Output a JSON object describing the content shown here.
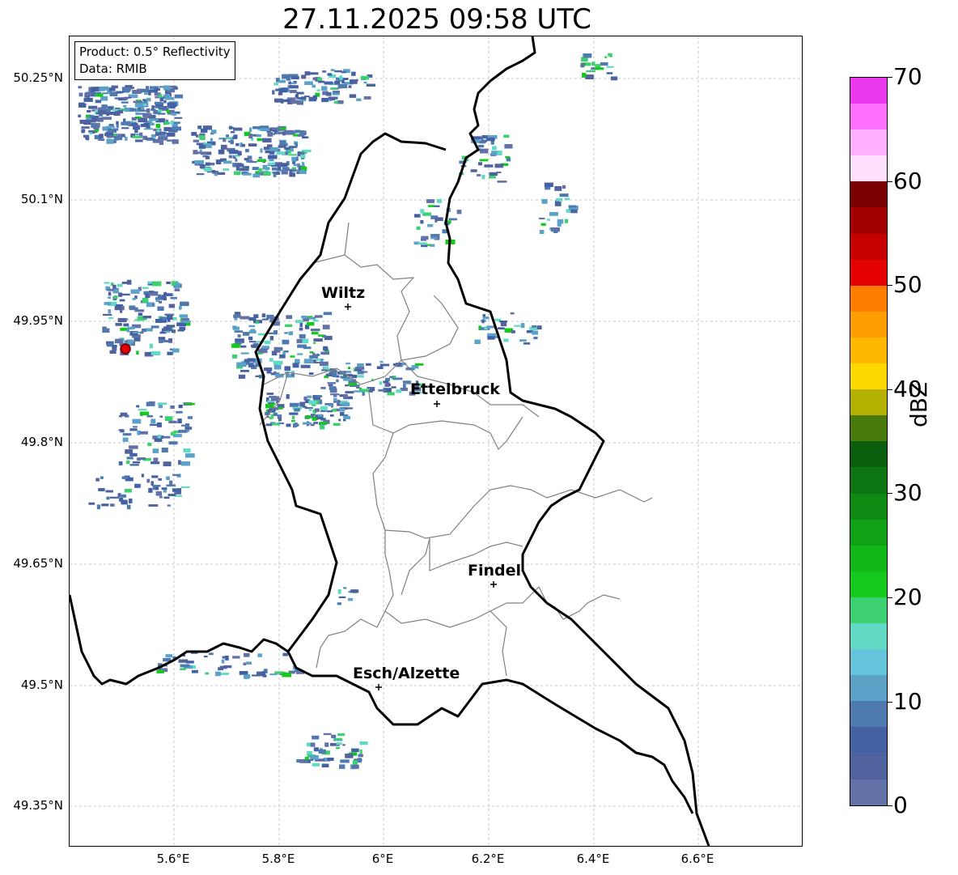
{
  "title": "27.11.2025 09:58 UTC",
  "info": {
    "line1": "Product: 0.5° Reflectivity",
    "line2": "Data: RMIB"
  },
  "y_ticks": [
    "50.25°N",
    "50.1°N",
    "49.95°N",
    "49.8°N",
    "49.65°N",
    "49.5°N",
    "49.35°N"
  ],
  "x_ticks": [
    "5.6°E",
    "5.8°E",
    "6°E",
    "6.2°E",
    "6.4°E",
    "6.6°E"
  ],
  "cities": {
    "wiltz": "Wiltz",
    "ettelbruck": "Ettelbruck",
    "findel": "Findel",
    "esch": "Esch/Alzette"
  },
  "colorbar": {
    "label": "dBZ",
    "ticks": [
      "70",
      "60",
      "50",
      "40",
      "30",
      "20",
      "10",
      "0"
    ],
    "colors": [
      "#6272a8",
      "#51639e",
      "#4461a3",
      "#4e7ab0",
      "#5ba1c8",
      "#66c3dc",
      "#62d9c5",
      "#3cd070",
      "#14c81c",
      "#12b818",
      "#10a114",
      "#0e8a12",
      "#0c7410",
      "#0a5e0e",
      "#4a7a0a",
      "#b4b000",
      "#ffd800",
      "#ffb800",
      "#ff9e00",
      "#ff7e00",
      "#e40000",
      "#c60000",
      "#a20000",
      "#780000",
      "#ffe0ff",
      "#ffb0ff",
      "#ff70ff",
      "#ec38ec"
    ]
  },
  "radar_site_color": "#e00000"
}
